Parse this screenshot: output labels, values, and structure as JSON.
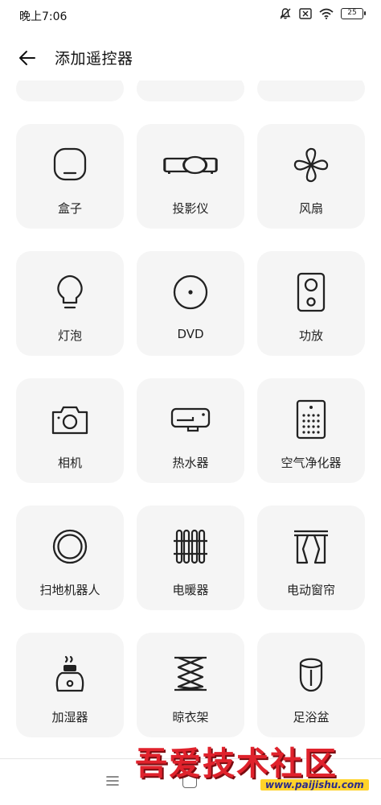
{
  "status_bar": {
    "time": "晚上7:06",
    "battery": "25",
    "icons": [
      "mute-icon",
      "sim-off-icon",
      "wifi-icon",
      "battery-icon"
    ]
  },
  "header": {
    "title": "添加遥控器",
    "back_icon": "back-arrow-icon"
  },
  "devices": [
    {
      "label": "盒子",
      "icon": "box-icon"
    },
    {
      "label": "投影仪",
      "icon": "projector-icon"
    },
    {
      "label": "风扇",
      "icon": "fan-icon"
    },
    {
      "label": "灯泡",
      "icon": "bulb-icon"
    },
    {
      "label": "DVD",
      "icon": "dvd-icon"
    },
    {
      "label": "功放",
      "icon": "amplifier-icon"
    },
    {
      "label": "相机",
      "icon": "camera-icon"
    },
    {
      "label": "热水器",
      "icon": "water-heater-icon"
    },
    {
      "label": "空气净化器",
      "icon": "air-purifier-icon"
    },
    {
      "label": "扫地机器人",
      "icon": "robot-vacuum-icon"
    },
    {
      "label": "电暖器",
      "icon": "heater-icon"
    },
    {
      "label": "电动窗帘",
      "icon": "curtain-icon"
    },
    {
      "label": "加湿器",
      "icon": "humidifier-icon"
    },
    {
      "label": "晾衣架",
      "icon": "clothes-rack-icon"
    },
    {
      "label": "足浴盆",
      "icon": "foot-bath-icon"
    }
  ],
  "nav": {
    "menu_icon": "menu-icon",
    "home_icon": "home-icon"
  },
  "watermark": {
    "title": "吾爱技术社区",
    "url": "www.paijishu.com"
  }
}
